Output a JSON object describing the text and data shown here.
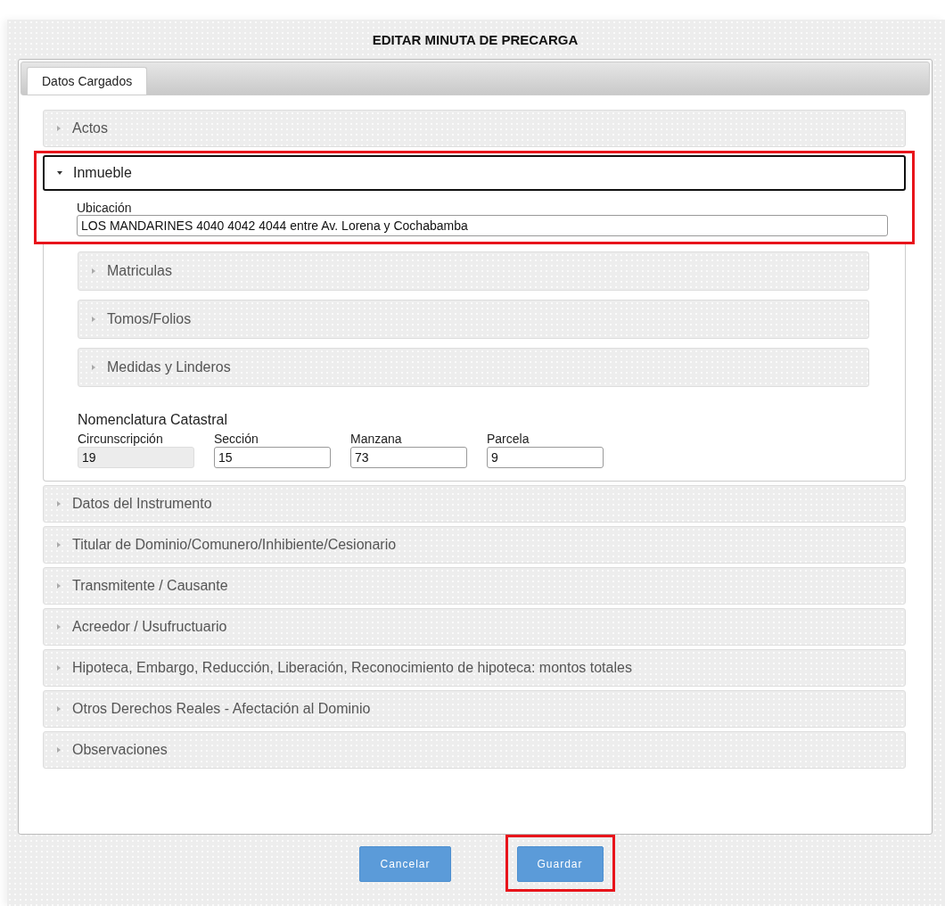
{
  "dialog": {
    "title": "EDITAR MINUTA DE PRECARGA"
  },
  "tabs": [
    {
      "label": "Datos Cargados",
      "selected": true
    }
  ],
  "sections": [
    {
      "title": "Actos",
      "expanded": false,
      "highlighted": false
    },
    {
      "title": "Inmueble",
      "expanded": true,
      "highlighted": true,
      "content": {
        "ubicacion": {
          "label": "Ubicación",
          "value": "LOS MANDARINES 4040 4042 4044 entre Av. Lorena y Cochabamba"
        },
        "subsections": [
          {
            "title": "Matriculas",
            "expanded": false
          },
          {
            "title": "Tomos/Folios",
            "expanded": false
          },
          {
            "title": "Medidas y Linderos",
            "expanded": false
          }
        ],
        "nomenclatura": {
          "title": "Nomenclatura Catastral",
          "fields": [
            {
              "label": "Circunscripción",
              "value": "19",
              "disabled": true
            },
            {
              "label": "Sección",
              "value": "15",
              "disabled": false
            },
            {
              "label": "Manzana",
              "value": "73",
              "disabled": false
            },
            {
              "label": "Parcela",
              "value": "9",
              "disabled": false
            }
          ]
        }
      }
    },
    {
      "title": "Datos del Instrumento",
      "expanded": false,
      "highlighted": false
    },
    {
      "title": "Titular de Dominio/Comunero/Inhibiente/Cesionario",
      "expanded": false,
      "highlighted": false
    },
    {
      "title": "Transmitente / Causante",
      "expanded": false,
      "highlighted": false
    },
    {
      "title": "Acreedor / Usufructuario",
      "expanded": false,
      "highlighted": false
    },
    {
      "title": "Hipoteca, Embargo, Reducción, Liberación, Reconocimiento de hipoteca: montos totales",
      "expanded": false,
      "highlighted": false
    },
    {
      "title": "Otros Derechos Reales - Afectación al Dominio",
      "expanded": false,
      "highlighted": false
    },
    {
      "title": "Observaciones",
      "expanded": false,
      "highlighted": false
    }
  ],
  "buttons": [
    {
      "label": "Cancelar",
      "highlighted": false
    },
    {
      "label": "Guardar",
      "highlighted": true
    }
  ]
}
